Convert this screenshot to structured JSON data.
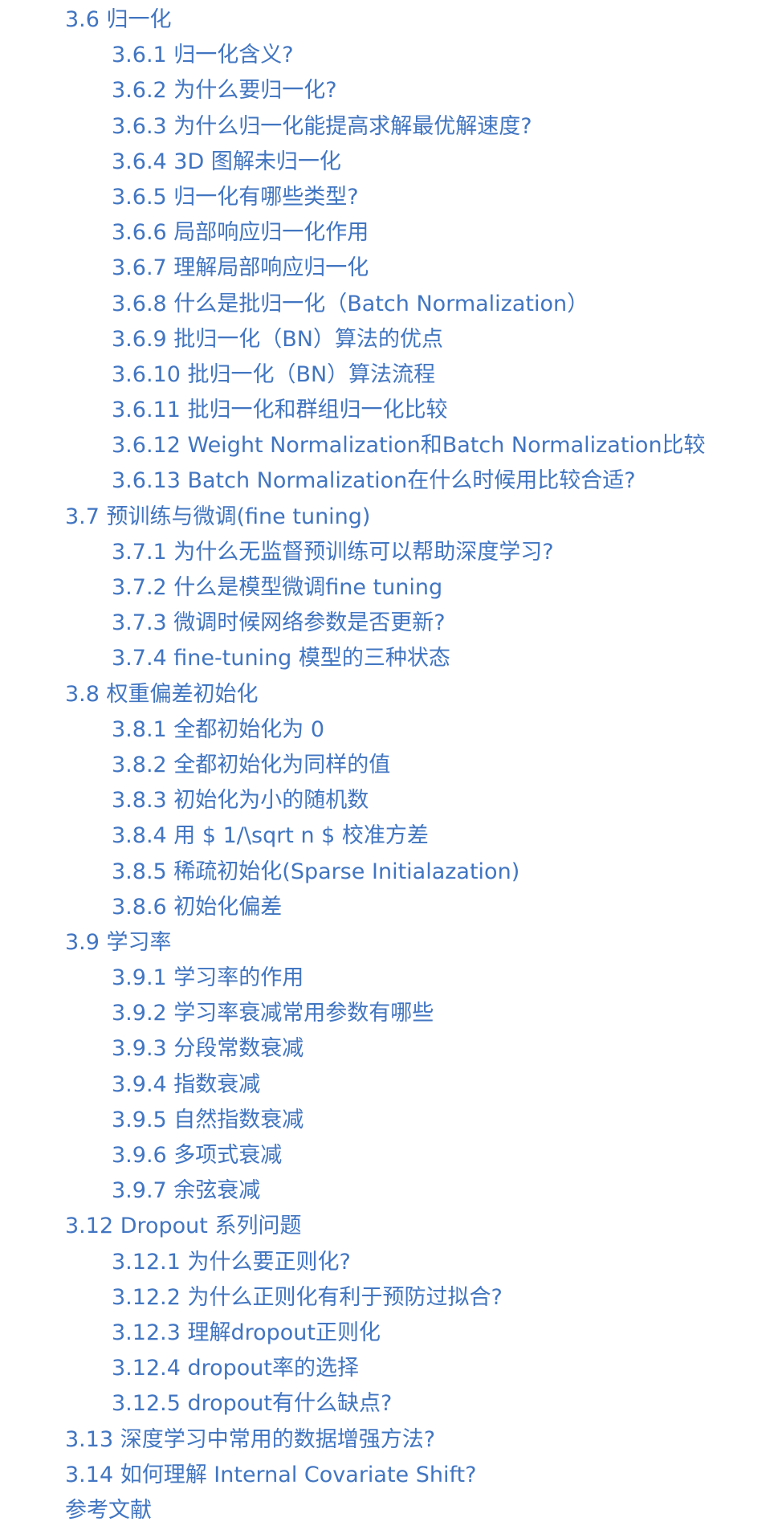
{
  "toc": {
    "items": [
      {
        "text": "3.6 归一化",
        "level": 1
      },
      {
        "text": "3.6.1 归一化含义?",
        "level": 2
      },
      {
        "text": "3.6.2 为什么要归一化?",
        "level": 2
      },
      {
        "text": "3.6.3 为什么归一化能提高求解最优解速度?",
        "level": 2
      },
      {
        "text": "3.6.4 3D 图解未归一化",
        "level": 2
      },
      {
        "text": "3.6.5 归一化有哪些类型?",
        "level": 2
      },
      {
        "text": "3.6.6 局部响应归一化作用",
        "level": 2
      },
      {
        "text": "3.6.7 理解局部响应归一化",
        "level": 2
      },
      {
        "text": "3.6.8 什么是批归一化（Batch Normalization）",
        "level": 2
      },
      {
        "text": "3.6.9 批归一化（BN）算法的优点",
        "level": 2
      },
      {
        "text": "3.6.10 批归一化（BN）算法流程",
        "level": 2
      },
      {
        "text": "3.6.11 批归一化和群组归一化比较",
        "level": 2
      },
      {
        "text": "3.6.12 Weight Normalization和Batch Normalization比较",
        "level": 2
      },
      {
        "text": "3.6.13 Batch Normalization在什么时候用比较合适?",
        "level": 2
      },
      {
        "text": "3.7 预训练与微调(fine tuning)",
        "level": 1
      },
      {
        "text": "3.7.1 为什么无监督预训练可以帮助深度学习?",
        "level": 2
      },
      {
        "text": "3.7.2 什么是模型微调fine tuning",
        "level": 2
      },
      {
        "text": "3.7.3 微调时候网络参数是否更新?",
        "level": 2
      },
      {
        "text": "3.7.4 fine-tuning 模型的三种状态",
        "level": 2
      },
      {
        "text": "3.8 权重偏差初始化",
        "level": 1
      },
      {
        "text": "3.8.1 全都初始化为 0",
        "level": 2
      },
      {
        "text": "3.8.2 全都初始化为同样的值",
        "level": 2
      },
      {
        "text": "3.8.3 初始化为小的随机数",
        "level": 2
      },
      {
        "text": "3.8.4 用 $ 1/\\sqrt n $ 校准方差",
        "level": 2
      },
      {
        "text": "3.8.5 稀疏初始化(Sparse Initialazation)",
        "level": 2
      },
      {
        "text": "3.8.6 初始化偏差",
        "level": 2
      },
      {
        "text": "3.9 学习率",
        "level": 1
      },
      {
        "text": "3.9.1 学习率的作用",
        "level": 2
      },
      {
        "text": "3.9.2 学习率衰减常用参数有哪些",
        "level": 2
      },
      {
        "text": "3.9.3 分段常数衰减",
        "level": 2
      },
      {
        "text": "3.9.4 指数衰减",
        "level": 2
      },
      {
        "text": "3.9.5 自然指数衰减",
        "level": 2
      },
      {
        "text": "3.9.6 多项式衰减",
        "level": 2
      },
      {
        "text": "3.9.7 余弦衰减",
        "level": 2
      },
      {
        "text": "3.12 Dropout 系列问题",
        "level": 1
      },
      {
        "text": "3.12.1 为什么要正则化?",
        "level": 2
      },
      {
        "text": "3.12.2 为什么正则化有利于预防过拟合?",
        "level": 2
      },
      {
        "text": "3.12.3 理解dropout正则化",
        "level": 2
      },
      {
        "text": "3.12.4 dropout率的选择",
        "level": 2
      },
      {
        "text": "3.12.5 dropout有什么缺点?",
        "level": 2
      },
      {
        "text": "3.13 深度学习中常用的数据增强方法?",
        "level": 1
      },
      {
        "text": "3.14 如何理解 Internal Covariate Shift?",
        "level": 1
      },
      {
        "text": "参考文献",
        "level": 1
      }
    ]
  },
  "colors": {
    "link": "#4175c1",
    "background": "#ffffff"
  }
}
